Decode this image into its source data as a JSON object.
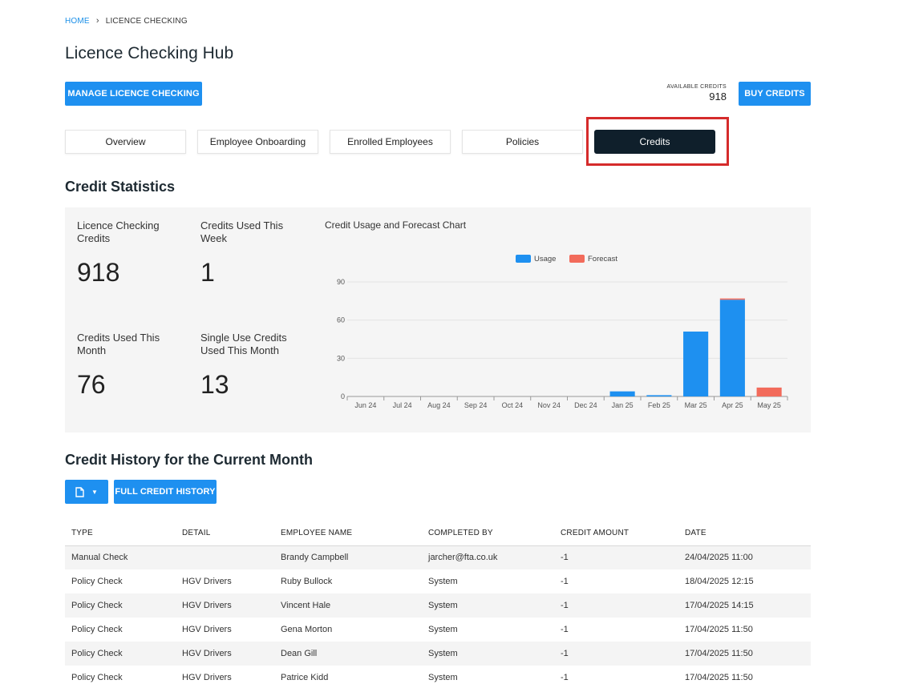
{
  "breadcrumb": {
    "home": "HOME",
    "separator": "›",
    "current": "LICENCE CHECKING"
  },
  "page_title": "Licence Checking Hub",
  "actions": {
    "manage_label": "MANAGE LICENCE CHECKING",
    "available_credits_label": "AVAILABLE CREDITS",
    "available_credits_value": "918",
    "buy_label": "BUY CREDITS"
  },
  "tabs": [
    {
      "label": "Overview",
      "active": false
    },
    {
      "label": "Employee Onboarding",
      "active": false
    },
    {
      "label": "Enrolled Employees",
      "active": false
    },
    {
      "label": "Policies",
      "active": false
    },
    {
      "label": "Credits",
      "active": true
    }
  ],
  "stats": {
    "title": "Credit Statistics",
    "items": [
      {
        "label": "Licence Checking Credits",
        "value": "918"
      },
      {
        "label": "Credits Used This Week",
        "value": "1"
      },
      {
        "label": "Credits Used This Month",
        "value": "76"
      },
      {
        "label": "Single Use Credits Used This Month",
        "value": "13"
      }
    ]
  },
  "chart_data": {
    "type": "bar",
    "title": "Credit Usage and Forecast Chart",
    "categories": [
      "Jun 24",
      "Jul 24",
      "Aug 24",
      "Sep 24",
      "Oct 24",
      "Nov 24",
      "Dec 24",
      "Jan 25",
      "Feb 25",
      "Mar 25",
      "Apr 25",
      "May 25"
    ],
    "series": [
      {
        "name": "Usage",
        "color": "#1e90f0",
        "values": [
          0,
          0,
          0,
          0,
          0,
          0,
          0,
          4,
          1,
          51,
          76,
          0
        ]
      },
      {
        "name": "Forecast",
        "color": "#f26b5b",
        "values": [
          0,
          0,
          0,
          0,
          0,
          0,
          0,
          0,
          0,
          0,
          1,
          7
        ]
      }
    ],
    "stacked": true,
    "ylim": [
      0,
      90
    ],
    "yticks": [
      0,
      30,
      60,
      90
    ],
    "legend": "top-center",
    "grid": true
  },
  "history": {
    "title": "Credit History for the Current Month",
    "export_icon": "document-icon",
    "full_history_label": "FULL CREDIT HISTORY",
    "columns": [
      "TYPE",
      "DETAIL",
      "EMPLOYEE NAME",
      "COMPLETED BY",
      "CREDIT AMOUNT",
      "DATE"
    ],
    "rows": [
      {
        "type": "Manual Check",
        "detail": "",
        "employee": "Brandy Campbell",
        "completed_by": "jarcher@fta.co.uk",
        "amount": "-1",
        "date": "24/04/2025 11:00"
      },
      {
        "type": "Policy Check",
        "detail": "HGV Drivers",
        "employee": "Ruby Bullock",
        "completed_by": "System",
        "amount": "-1",
        "date": "18/04/2025 12:15"
      },
      {
        "type": "Policy Check",
        "detail": "HGV Drivers",
        "employee": "Vincent Hale",
        "completed_by": "System",
        "amount": "-1",
        "date": "17/04/2025 14:15"
      },
      {
        "type": "Policy Check",
        "detail": "HGV Drivers",
        "employee": "Gena Morton",
        "completed_by": "System",
        "amount": "-1",
        "date": "17/04/2025 11:50"
      },
      {
        "type": "Policy Check",
        "detail": "HGV Drivers",
        "employee": "Dean Gill",
        "completed_by": "System",
        "amount": "-1",
        "date": "17/04/2025 11:50"
      },
      {
        "type": "Policy Check",
        "detail": "HGV Drivers",
        "employee": "Patrice Kidd",
        "completed_by": "System",
        "amount": "-1",
        "date": "17/04/2025 11:50"
      }
    ]
  }
}
